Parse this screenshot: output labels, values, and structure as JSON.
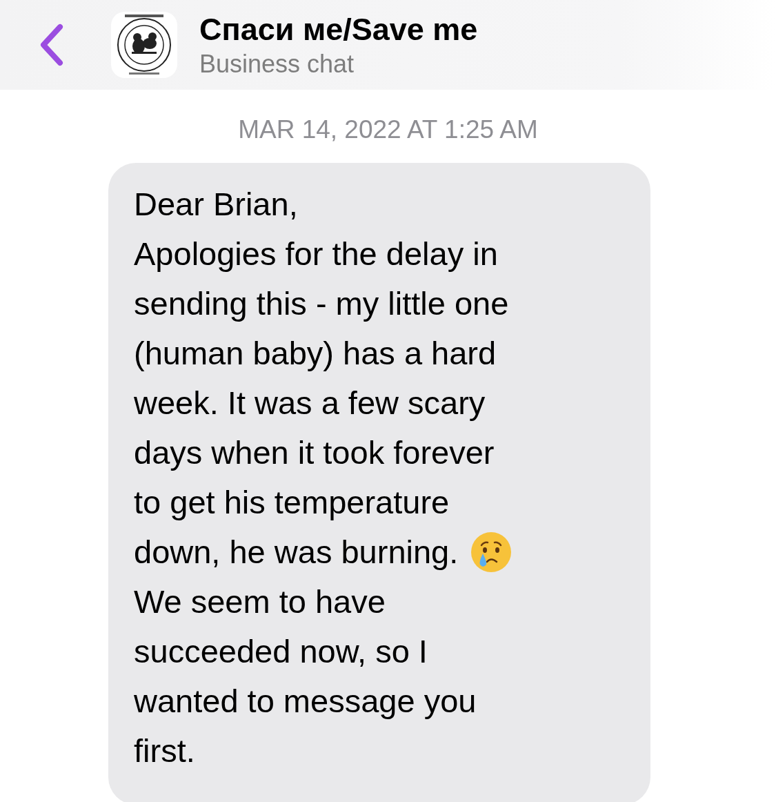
{
  "header": {
    "title": "Спаси ме/Save me",
    "subtitle": "Business chat"
  },
  "timestamp": "MAR 14, 2022 AT 1:25 AM",
  "message": {
    "lines": [
      {
        "text": "Dear Brian,"
      },
      {
        "text": "Apologies for the delay in"
      },
      {
        "text": "sending this - my little one"
      },
      {
        "text": "(human baby) has a hard"
      },
      {
        "text": "week. It was a few scary"
      },
      {
        "text": "days when it took forever"
      },
      {
        "text": "to get his temperature"
      },
      {
        "text": "down, he was burning.",
        "kind": "with_crying_face"
      },
      {
        "text": "We seem to have"
      },
      {
        "text": "succeeded now, so I"
      },
      {
        "text": "wanted to message you"
      },
      {
        "text": "first."
      }
    ]
  }
}
